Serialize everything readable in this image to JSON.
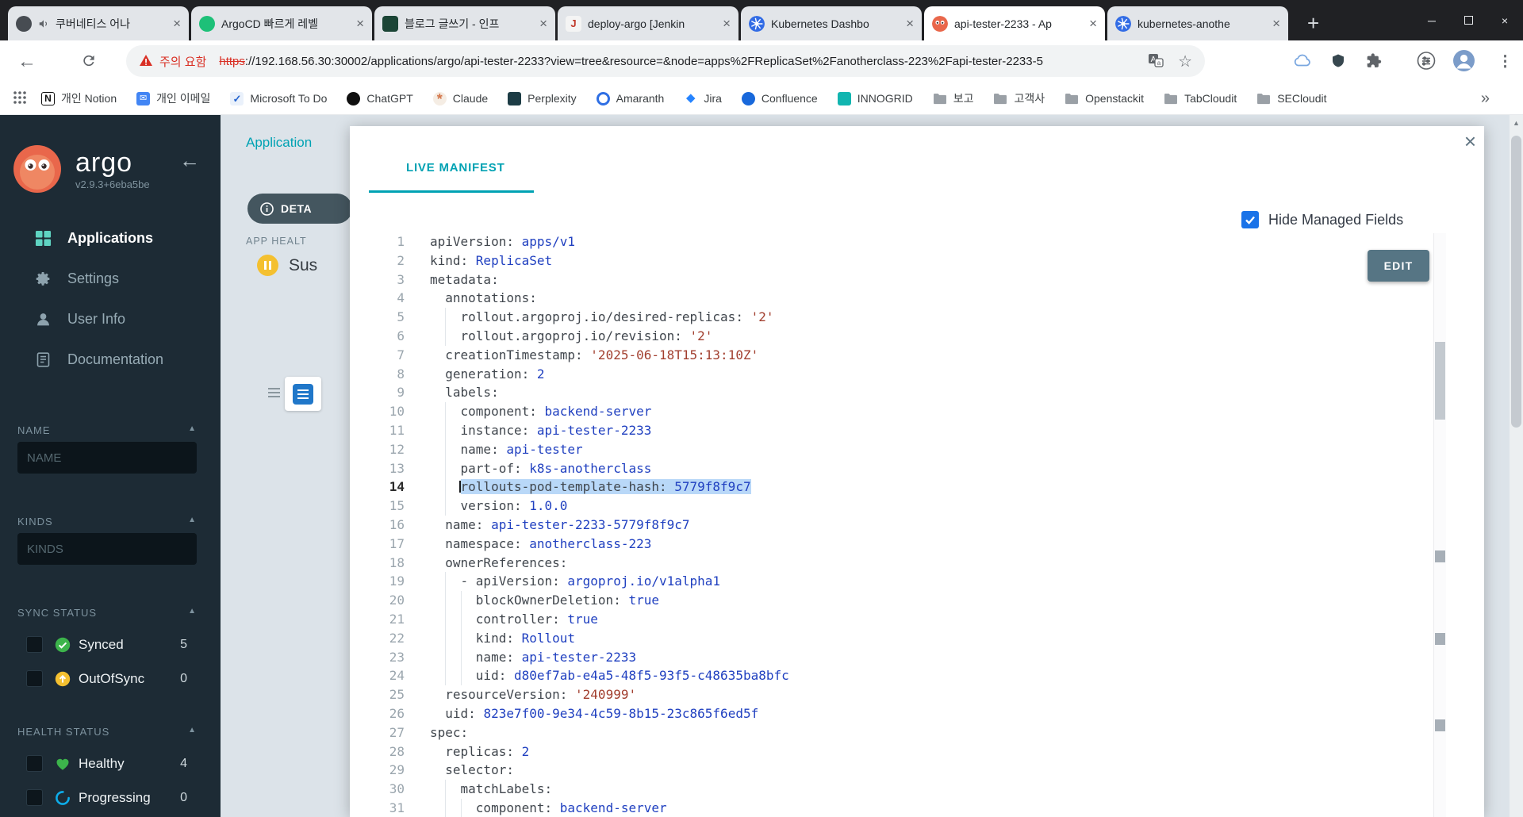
{
  "colors": {
    "accent_teal": "#00a2b3",
    "selection_blue": "#b9d8f8",
    "synced_green": "#3cb44b",
    "out_of_sync_yellow": "#f4c030",
    "healthy_green": "#3cb44b",
    "progressing_blue": "#0dadea",
    "suspended_yellow": "#f4c030",
    "edit_button_slate": "#567584",
    "checkbox_blue": "#1a73e8",
    "yaml_key": "#40464d",
    "yaml_value": "#2040c0",
    "yaml_string": "#a23f2f",
    "warning_red": "#d93025"
  },
  "browser": {
    "tabs": [
      {
        "title": "쿠버네티스 어나",
        "icon": "course",
        "audio": true
      },
      {
        "title": "ArgoCD 빠르게 레벨",
        "icon": "inflearn"
      },
      {
        "title": "블로그 글쓰기 - 인프",
        "icon": "blog"
      },
      {
        "title": "deploy-argo [Jenkin",
        "icon": "jenkins"
      },
      {
        "title": "Kubernetes Dashbo",
        "icon": "k8s"
      },
      {
        "title": "api-tester-2233 - Ap",
        "icon": "argo",
        "active": true
      },
      {
        "title": "kubernetes-anothe",
        "icon": "k8s"
      }
    ],
    "address": {
      "warning": "주의 요함",
      "scheme": "https",
      "rest": "://192.168.56.30:30002/applications/argo/api-tester-2233?view=tree&resource=&node=apps%2FReplicaSet%2Fanotherclass-223%2Fapi-tester-2233-5"
    },
    "bookmarks": [
      {
        "label": "개인 Notion",
        "icon": "notion"
      },
      {
        "label": "개인 이메일",
        "icon": "mail"
      },
      {
        "label": "Microsoft To Do",
        "icon": "todo"
      },
      {
        "label": "ChatGPT",
        "icon": "chatgpt"
      },
      {
        "label": "Claude",
        "icon": "claude"
      },
      {
        "label": "Perplexity",
        "icon": "perplexity"
      },
      {
        "label": "Amaranth",
        "icon": "amaranth"
      },
      {
        "label": "Jira",
        "icon": "jira"
      },
      {
        "label": "Confluence",
        "icon": "confluence"
      },
      {
        "label": "INNOGRID",
        "icon": "innogrid"
      },
      {
        "label": "보고",
        "icon": "folder"
      },
      {
        "label": "고객사",
        "icon": "folder"
      },
      {
        "label": "Openstackit",
        "icon": "folder"
      },
      {
        "label": "TabCloudit",
        "icon": "folder"
      },
      {
        "label": "SECloudit",
        "icon": "folder"
      }
    ]
  },
  "sidebar": {
    "logo_text": "argo",
    "version": "v2.9.3+6eba5be",
    "menu": [
      {
        "label": "Applications",
        "icon": "applications",
        "active": true
      },
      {
        "label": "Settings",
        "icon": "settings"
      },
      {
        "label": "User Info",
        "icon": "user"
      },
      {
        "label": "Documentation",
        "icon": "docs"
      }
    ],
    "filters": [
      {
        "header": "NAME",
        "input_placeholder": "NAME"
      },
      {
        "header": "KINDS",
        "input_placeholder": "KINDS"
      },
      {
        "header": "SYNC STATUS",
        "rows": [
          {
            "label": "Synced",
            "count": "5",
            "icon": "synced"
          },
          {
            "label": "OutOfSync",
            "count": "0",
            "icon": "outofsync"
          }
        ]
      },
      {
        "header": "HEALTH STATUS",
        "rows": [
          {
            "label": "Healthy",
            "count": "4",
            "icon": "healthy"
          },
          {
            "label": "Progressing",
            "count": "0",
            "icon": "progressing"
          }
        ]
      }
    ]
  },
  "page": {
    "breadcrumb": "Application",
    "details_button": "DETA",
    "app_health_label": "APP HEALT",
    "status_text": "Sus"
  },
  "panel": {
    "tab_label": "LIVE MANIFEST",
    "hide_managed_label": "Hide Managed Fields",
    "hide_managed_checked": true,
    "edit_button": "EDIT",
    "manifest": {
      "language": "yaml",
      "selected_line": 14,
      "lines": [
        {
          "n": 1,
          "ind": 0,
          "toks": [
            [
              "k",
              "apiVersion"
            ],
            [
              "p",
              ": "
            ],
            [
              "v",
              "apps/v1"
            ]
          ]
        },
        {
          "n": 2,
          "ind": 0,
          "toks": [
            [
              "k",
              "kind"
            ],
            [
              "p",
              ": "
            ],
            [
              "v",
              "ReplicaSet"
            ]
          ]
        },
        {
          "n": 3,
          "ind": 0,
          "toks": [
            [
              "k",
              "metadata"
            ],
            [
              "p",
              ":"
            ]
          ]
        },
        {
          "n": 4,
          "ind": 2,
          "toks": [
            [
              "k",
              "annotations"
            ],
            [
              "p",
              ":"
            ]
          ]
        },
        {
          "n": 5,
          "ind": 4,
          "toks": [
            [
              "k",
              "rollout.argoproj.io/desired-replicas"
            ],
            [
              "p",
              ": "
            ],
            [
              "s",
              "'2'"
            ]
          ]
        },
        {
          "n": 6,
          "ind": 4,
          "toks": [
            [
              "k",
              "rollout.argoproj.io/revision"
            ],
            [
              "p",
              ": "
            ],
            [
              "s",
              "'2'"
            ]
          ]
        },
        {
          "n": 7,
          "ind": 2,
          "toks": [
            [
              "k",
              "creationTimestamp"
            ],
            [
              "p",
              ": "
            ],
            [
              "s",
              "'2025-06-18T15:13:10Z'"
            ]
          ]
        },
        {
          "n": 8,
          "ind": 2,
          "toks": [
            [
              "k",
              "generation"
            ],
            [
              "p",
              ": "
            ],
            [
              "v",
              "2"
            ]
          ]
        },
        {
          "n": 9,
          "ind": 2,
          "toks": [
            [
              "k",
              "labels"
            ],
            [
              "p",
              ":"
            ]
          ]
        },
        {
          "n": 10,
          "ind": 4,
          "toks": [
            [
              "k",
              "component"
            ],
            [
              "p",
              ": "
            ],
            [
              "v",
              "backend-server"
            ]
          ]
        },
        {
          "n": 11,
          "ind": 4,
          "toks": [
            [
              "k",
              "instance"
            ],
            [
              "p",
              ": "
            ],
            [
              "v",
              "api-tester-2233"
            ]
          ]
        },
        {
          "n": 12,
          "ind": 4,
          "toks": [
            [
              "k",
              "name"
            ],
            [
              "p",
              ": "
            ],
            [
              "v",
              "api-tester"
            ]
          ]
        },
        {
          "n": 13,
          "ind": 4,
          "toks": [
            [
              "k",
              "part-of"
            ],
            [
              "p",
              ": "
            ],
            [
              "v",
              "k8s-anotherclass"
            ]
          ]
        },
        {
          "n": 14,
          "ind": 4,
          "sel": true,
          "toks": [
            [
              "k",
              "rollouts-pod-template-hash"
            ],
            [
              "p",
              ": "
            ],
            [
              "v",
              "5779f8f9c7"
            ]
          ]
        },
        {
          "n": 15,
          "ind": 4,
          "toks": [
            [
              "k",
              "version"
            ],
            [
              "p",
              ": "
            ],
            [
              "v",
              "1.0.0"
            ]
          ]
        },
        {
          "n": 16,
          "ind": 2,
          "toks": [
            [
              "k",
              "name"
            ],
            [
              "p",
              ": "
            ],
            [
              "v",
              "api-tester-2233-5779f8f9c7"
            ]
          ]
        },
        {
          "n": 17,
          "ind": 2,
          "toks": [
            [
              "k",
              "namespace"
            ],
            [
              "p",
              ": "
            ],
            [
              "v",
              "anotherclass-223"
            ]
          ]
        },
        {
          "n": 18,
          "ind": 2,
          "toks": [
            [
              "k",
              "ownerReferences"
            ],
            [
              "p",
              ":"
            ]
          ]
        },
        {
          "n": 19,
          "ind": 4,
          "toks": [
            [
              "p",
              "- "
            ],
            [
              "k",
              "apiVersion"
            ],
            [
              "p",
              ": "
            ],
            [
              "v",
              "argoproj.io/v1alpha1"
            ]
          ]
        },
        {
          "n": 20,
          "ind": 6,
          "toks": [
            [
              "k",
              "blockOwnerDeletion"
            ],
            [
              "p",
              ": "
            ],
            [
              "v",
              "true"
            ]
          ]
        },
        {
          "n": 21,
          "ind": 6,
          "toks": [
            [
              "k",
              "controller"
            ],
            [
              "p",
              ": "
            ],
            [
              "v",
              "true"
            ]
          ]
        },
        {
          "n": 22,
          "ind": 6,
          "toks": [
            [
              "k",
              "kind"
            ],
            [
              "p",
              ": "
            ],
            [
              "v",
              "Rollout"
            ]
          ]
        },
        {
          "n": 23,
          "ind": 6,
          "toks": [
            [
              "k",
              "name"
            ],
            [
              "p",
              ": "
            ],
            [
              "v",
              "api-tester-2233"
            ]
          ]
        },
        {
          "n": 24,
          "ind": 6,
          "toks": [
            [
              "k",
              "uid"
            ],
            [
              "p",
              ": "
            ],
            [
              "v",
              "d80ef7ab-e4a5-48f5-93f5-c48635ba8bfc"
            ]
          ]
        },
        {
          "n": 25,
          "ind": 2,
          "toks": [
            [
              "k",
              "resourceVersion"
            ],
            [
              "p",
              ": "
            ],
            [
              "s",
              "'240999'"
            ]
          ]
        },
        {
          "n": 26,
          "ind": 2,
          "toks": [
            [
              "k",
              "uid"
            ],
            [
              "p",
              ": "
            ],
            [
              "v",
              "823e7f00-9e34-4c59-8b15-23c865f6ed5f"
            ]
          ]
        },
        {
          "n": 27,
          "ind": 0,
          "toks": [
            [
              "k",
              "spec"
            ],
            [
              "p",
              ":"
            ]
          ]
        },
        {
          "n": 28,
          "ind": 2,
          "toks": [
            [
              "k",
              "replicas"
            ],
            [
              "p",
              ": "
            ],
            [
              "v",
              "2"
            ]
          ]
        },
        {
          "n": 29,
          "ind": 2,
          "toks": [
            [
              "k",
              "selector"
            ],
            [
              "p",
              ":"
            ]
          ]
        },
        {
          "n": 30,
          "ind": 4,
          "toks": [
            [
              "k",
              "matchLabels"
            ],
            [
              "p",
              ":"
            ]
          ]
        },
        {
          "n": 31,
          "ind": 6,
          "toks": [
            [
              "k",
              "component"
            ],
            [
              "p",
              ": "
            ],
            [
              "v",
              "backend-server"
            ]
          ]
        }
      ]
    }
  }
}
